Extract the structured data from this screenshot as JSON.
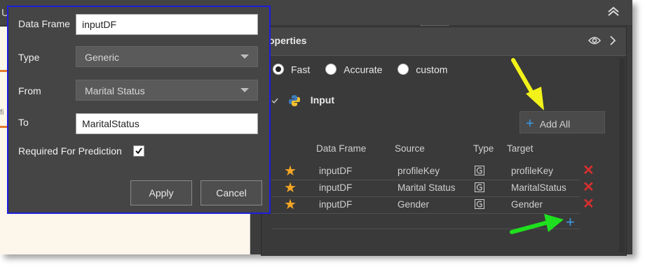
{
  "topbar": {
    "partial_label": "U"
  },
  "canvas": {
    "partial_text": "fi"
  },
  "properties": {
    "title": "operties",
    "modes": [
      {
        "label": "Fast",
        "selected": true
      },
      {
        "label": "Accurate",
        "selected": false
      },
      {
        "label": "custom",
        "selected": false
      }
    ],
    "input_section_label": "Input",
    "add_all_label": "Add All",
    "columns": [
      "Data Frame",
      "Source",
      "Type",
      "Target"
    ],
    "rows": [
      {
        "data_frame": "inputDF",
        "source": "profileKey",
        "type_icon": "g-type-icon",
        "target": "profileKey"
      },
      {
        "data_frame": "inputDF",
        "source": "Marital Status",
        "type_icon": "g-type-icon",
        "target": "MaritalStatus"
      },
      {
        "data_frame": "inputDF",
        "source": "Gender",
        "type_icon": "g-type-icon",
        "target": "Gender"
      }
    ],
    "colors": {
      "star": "#f5a623",
      "delete": "#d62f2f",
      "plus": "#3c9be8"
    }
  },
  "dialog": {
    "data_frame_label": "Data Frame",
    "data_frame_value": "inputDF",
    "type_label": "Type",
    "type_value": "Generic",
    "from_label": "From",
    "from_value": "Marital Status",
    "to_label": "To",
    "to_value": "MaritalStatus",
    "required_label": "Required For Prediction",
    "required_checked": true,
    "apply_label": "Apply",
    "cancel_label": "Cancel",
    "border_color": "#1d1de0"
  },
  "annotations": {
    "yellow_arrow": "#f2f21a",
    "green_arrow": "#1fe01f"
  }
}
